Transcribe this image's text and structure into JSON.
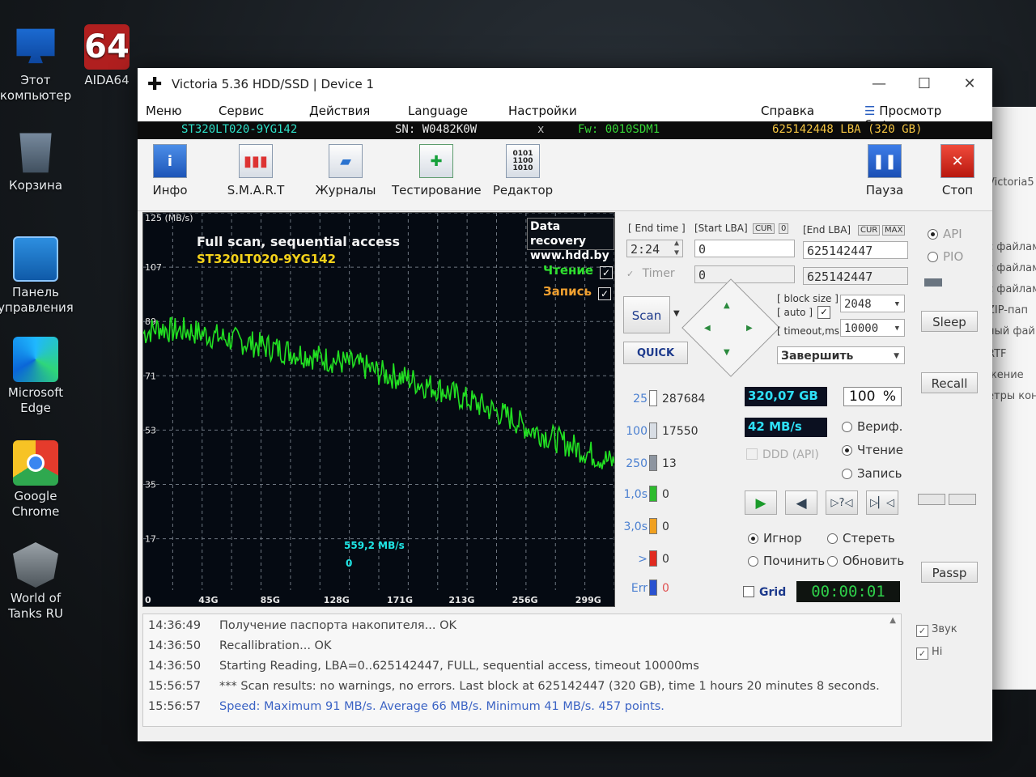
{
  "desktop": {
    "icons": [
      {
        "label": "Этот компьютер",
        "icon": "computer-icon"
      },
      {
        "label": "Корзина",
        "icon": "recycle-bin-icon"
      },
      {
        "label": "Панель управления",
        "icon": "control-panel-icon"
      },
      {
        "label": "Microsoft Edge",
        "icon": "edge-icon"
      },
      {
        "label": "Google Chrome",
        "icon": "chrome-icon"
      },
      {
        "label": "World of Tanks RU",
        "icon": "world-of-tanks-icon"
      },
      {
        "label": "AIDA64",
        "icon_text": "64",
        "icon": "aida64-icon"
      }
    ]
  },
  "window": {
    "title": "Victoria 5.36 HDD/SSD | Device 1",
    "controls": {
      "minimize": "—",
      "maximize": "☐",
      "close": "✕"
    }
  },
  "menu": {
    "items": [
      "Меню",
      "Сервис",
      "Действия",
      "Language",
      "Настройки",
      "Справка"
    ],
    "buffer_view": "Просмотр буфера"
  },
  "drive": {
    "model": "ST320LT020-9YG142",
    "serial": "SN: W0482K0W",
    "close_mark": "x",
    "firmware": "Fw: 0010SDM1",
    "capacity": "625142448 LBA (320 GB)"
  },
  "toolbar": {
    "info": "Инфо",
    "smart": "S.M.A.R.T",
    "logs": "Журналы",
    "testing": "Тестирование",
    "editor": "Редактор",
    "pause": "Пауза",
    "stop": "Стоп"
  },
  "graph": {
    "scan_title": "Full scan, sequential access",
    "model": "ST320LT020-9YG142",
    "promo_line1": "Data recovery",
    "promo_line2": "www.hdd.by",
    "read_label": "Чтение",
    "write_label": "Запись",
    "speed_label": "559,2 MB/s",
    "zero_label": "0"
  },
  "chart_data": {
    "type": "line",
    "title": "Full scan, sequential access",
    "xlabel": "",
    "ylabel": "125 (MB/s)",
    "ylim": [
      0,
      125
    ],
    "xlim": [
      0,
      320
    ],
    "x_ticks": [
      "0",
      "43G",
      "85G",
      "128G",
      "171G",
      "213G",
      "256G",
      "299G"
    ],
    "y_ticks": [
      "107",
      "89",
      "71",
      "53",
      "35",
      "17"
    ],
    "grid": true,
    "series": [
      {
        "name": "Чтение",
        "color": "#22e022",
        "x": [
          0,
          10,
          20,
          30,
          40,
          50,
          60,
          70,
          80,
          90,
          100,
          110,
          120,
          130,
          140,
          150,
          160,
          170,
          180,
          190,
          200,
          210,
          220,
          230,
          240,
          250,
          260,
          270,
          280,
          290,
          300,
          310,
          320
        ],
        "y": [
          85,
          87,
          86,
          86,
          85,
          84,
          83,
          82,
          81,
          80,
          79,
          78,
          77,
          76,
          75,
          74,
          72,
          71,
          70,
          68,
          67,
          65,
          63,
          61,
          59,
          57,
          54,
          52,
          50,
          48,
          46,
          44,
          42
        ]
      }
    ]
  },
  "scan": {
    "end_time_hdr": "[ End time ]",
    "start_lba_hdr": "[Start LBA]",
    "cur_tag": "CUR",
    "zero_tag": "0",
    "end_lba_hdr": "[End LBA]",
    "cur_tag2": "CUR",
    "max_tag": "MAX",
    "end_time": "2:24",
    "start_lba": "0",
    "end_lba": "625142447",
    "timer_label": "Timer",
    "timer_value": "0",
    "end_lba2": "625142447",
    "block_size_hdr": "[ block size ]",
    "auto_hdr": "[ auto ]",
    "timeout_hdr": "[ timeout,ms ]",
    "block_size": "2048",
    "timeout": "10000",
    "scan_button": "Scan",
    "quick_button": "QUICK",
    "finish_select": "Завершить"
  },
  "stats": {
    "rows": [
      {
        "label": "25",
        "count": "287684",
        "color": "#ffffff"
      },
      {
        "label": "100",
        "count": "17550",
        "color": "#d8dde4"
      },
      {
        "label": "250",
        "count": "13",
        "color": "#8d95a0"
      },
      {
        "label": "1,0s",
        "count": "0",
        "color": "#2dbb2d"
      },
      {
        "label": "3,0s",
        "count": "0",
        "color": "#f0a020"
      },
      {
        "label": ">",
        "count": "0",
        "color": "#e02a20"
      },
      {
        "label": "Err",
        "count": "0",
        "color": "#2a52d0"
      }
    ],
    "size_done": "320,07 GB",
    "percent": "100",
    "percent_sign": "%",
    "speed": "42 MB/s",
    "ddd_api": "DDD (API)",
    "mode_verify": "Вериф.",
    "mode_read": "Чтение",
    "mode_write": "Запись"
  },
  "actions": {
    "ignore": "Игнор",
    "erase": "Стереть",
    "repair": "Починить",
    "refresh": "Обновить",
    "grid_label": "Grid",
    "timer_display": "00:00:01"
  },
  "side": {
    "api": "API",
    "pio": "PIO",
    "sleep": "Sleep",
    "recall": "Recall",
    "passp": "Passp",
    "sound": "Звук",
    "hints": "Hi"
  },
  "log": {
    "rows": [
      {
        "time": "14:36:49",
        "text": "Получение паспорта накопителя... OK"
      },
      {
        "time": "14:36:50",
        "text": "Recallibration... OK"
      },
      {
        "time": "14:36:50",
        "text": "Starting Reading, LBA=0..625142447, FULL, sequential access, timeout 10000ms"
      },
      {
        "time": "15:56:57",
        "text": "*** Scan results: no warnings, no errors. Last block at 625142447 (320 GB), time 1 hours 20 minutes 8 seconds."
      },
      {
        "time": "15:56:57",
        "text": "Speed: Maximum 91 MB/s. Average 66 MB/s. Minimum 41 MB/s. 457 points."
      }
    ]
  },
  "background_window": {
    "lines": [
      "Victoria5",
      "с файлам",
      "с файлам",
      "с файлам",
      "ZIP-пап",
      "ный фай",
      "RTF",
      "жение",
      "етры кон"
    ]
  }
}
